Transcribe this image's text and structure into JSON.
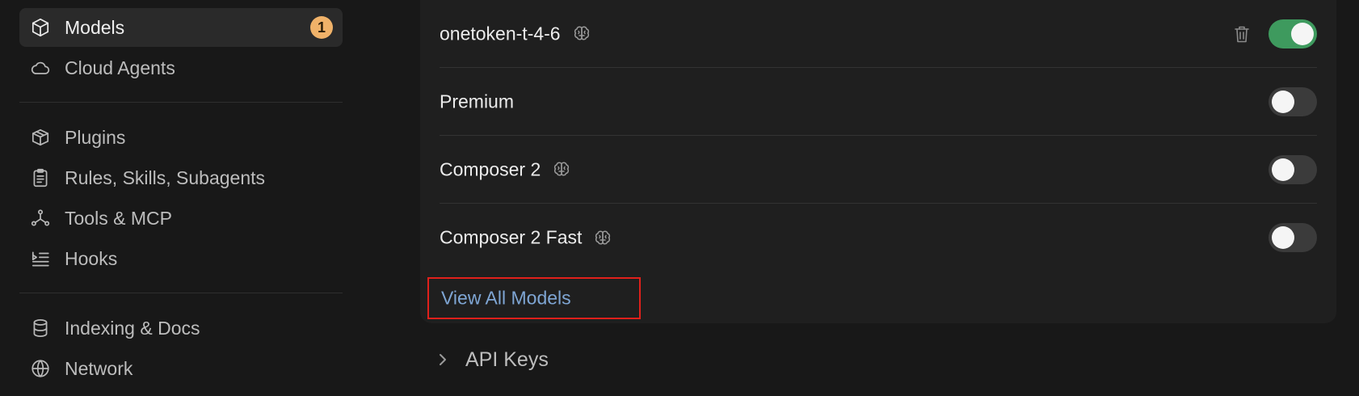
{
  "sidebar": {
    "items": [
      {
        "label": "Models",
        "icon": "cube-icon",
        "active": true,
        "badge": "1"
      },
      {
        "label": "Cloud Agents",
        "icon": "cloud-icon"
      },
      {
        "label": "Plugins",
        "icon": "package-icon"
      },
      {
        "label": "Rules, Skills, Subagents",
        "icon": "clipboard-icon"
      },
      {
        "label": "Tools & MCP",
        "icon": "network-nodes-icon"
      },
      {
        "label": "Hooks",
        "icon": "hooks-list-icon"
      },
      {
        "label": "Indexing & Docs",
        "icon": "database-icon"
      },
      {
        "label": "Network",
        "icon": "globe-icon"
      }
    ]
  },
  "models": {
    "rows": [
      {
        "name": "onetoken-t-4-6",
        "thinking": true,
        "deletable": true,
        "enabled": true
      },
      {
        "name": "Premium",
        "thinking": false,
        "deletable": false,
        "enabled": false
      },
      {
        "name": "Composer 2",
        "thinking": true,
        "deletable": false,
        "enabled": false
      },
      {
        "name": "Composer 2 Fast",
        "thinking": true,
        "deletable": false,
        "enabled": false
      }
    ],
    "view_all_label": "View All Models"
  },
  "api_keys": {
    "label": "API Keys"
  },
  "colors": {
    "accent_link": "#7fa6d4",
    "toggle_on": "#3e9a5e",
    "badge": "#f0b269",
    "highlight_box": "#e0201b"
  }
}
